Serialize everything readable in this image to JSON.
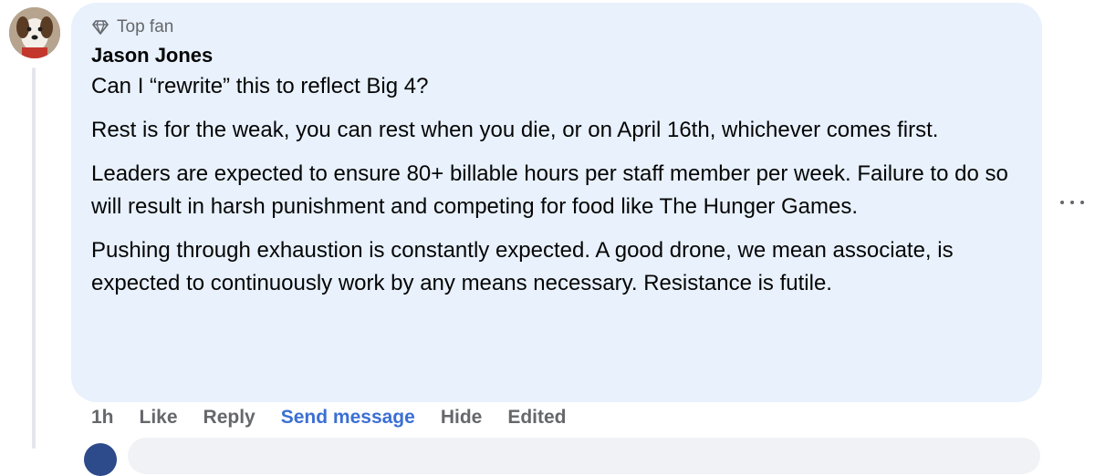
{
  "comment": {
    "badge_icon": "diamond-icon",
    "badge_label": "Top fan",
    "author": "Jason Jones",
    "paragraphs": [
      "Can I “rewrite” this to reflect Big 4?",
      "Rest is for the weak, you can rest when you die, or on April 16th, whichever comes first.",
      "Leaders are expected to ensure 80+ billable hours per staff member per week. Failure to do so will result in harsh punishment and competing for food like The Hunger Games.",
      "Pushing through exhaustion is constantly expected. A good drone, we mean associate, is expected to continuously work by any means necessary. Resistance is futile."
    ]
  },
  "actions": {
    "timestamp": "1h",
    "like": "Like",
    "reply": "Reply",
    "send_message": "Send message",
    "hide": "Hide",
    "edited": "Edited"
  },
  "colors": {
    "bubble": "#e8f1fc",
    "secondary_text": "#65676b",
    "link_blue": "#3b6fd4"
  }
}
